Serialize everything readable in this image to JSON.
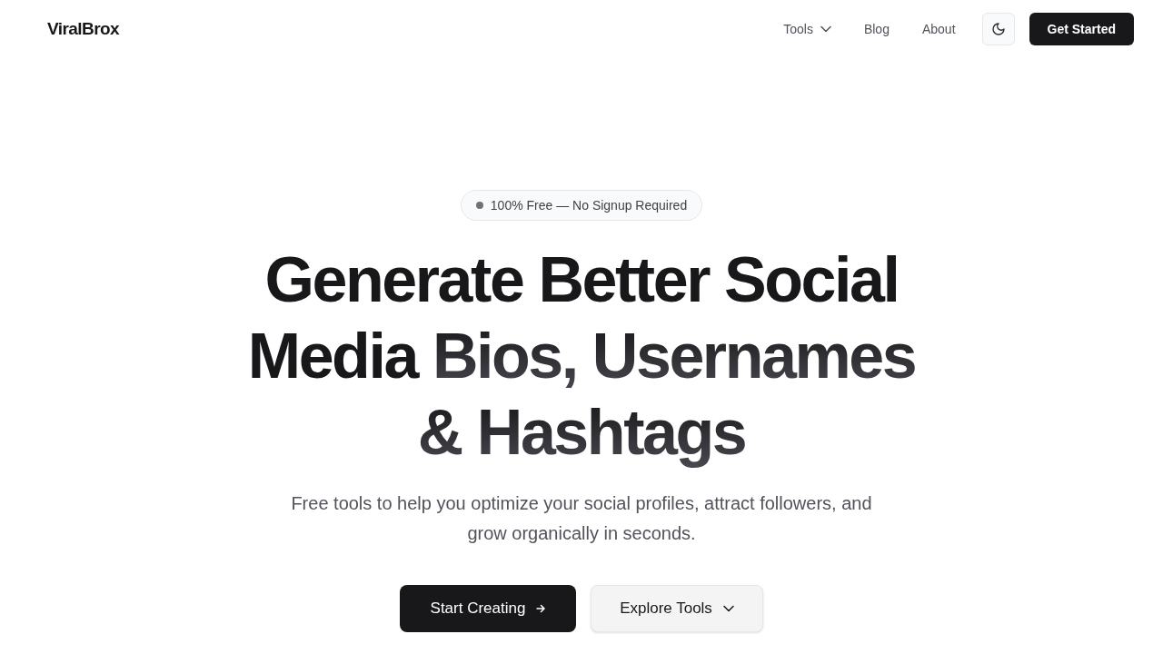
{
  "header": {
    "logo": "ViralBrox",
    "nav": [
      {
        "label": "Tools",
        "kind": "dropdown"
      },
      {
        "label": "Blog",
        "kind": "link"
      },
      {
        "label": "About",
        "kind": "link"
      }
    ],
    "cta": "Get Started"
  },
  "hero": {
    "badge": "100% Free — No Signup Required",
    "headline": {
      "lead": "Generate Better Social Media",
      "highlight": "Bios, Usernames & Hashtags"
    },
    "subtitle": "Free tools to help you optimize your social profiles, attract followers, and grow organically in seconds.",
    "buttons": [
      {
        "label": "Start Creating",
        "kind": "primary"
      },
      {
        "label": "Explore Tools",
        "kind": "secondary"
      }
    ]
  }
}
